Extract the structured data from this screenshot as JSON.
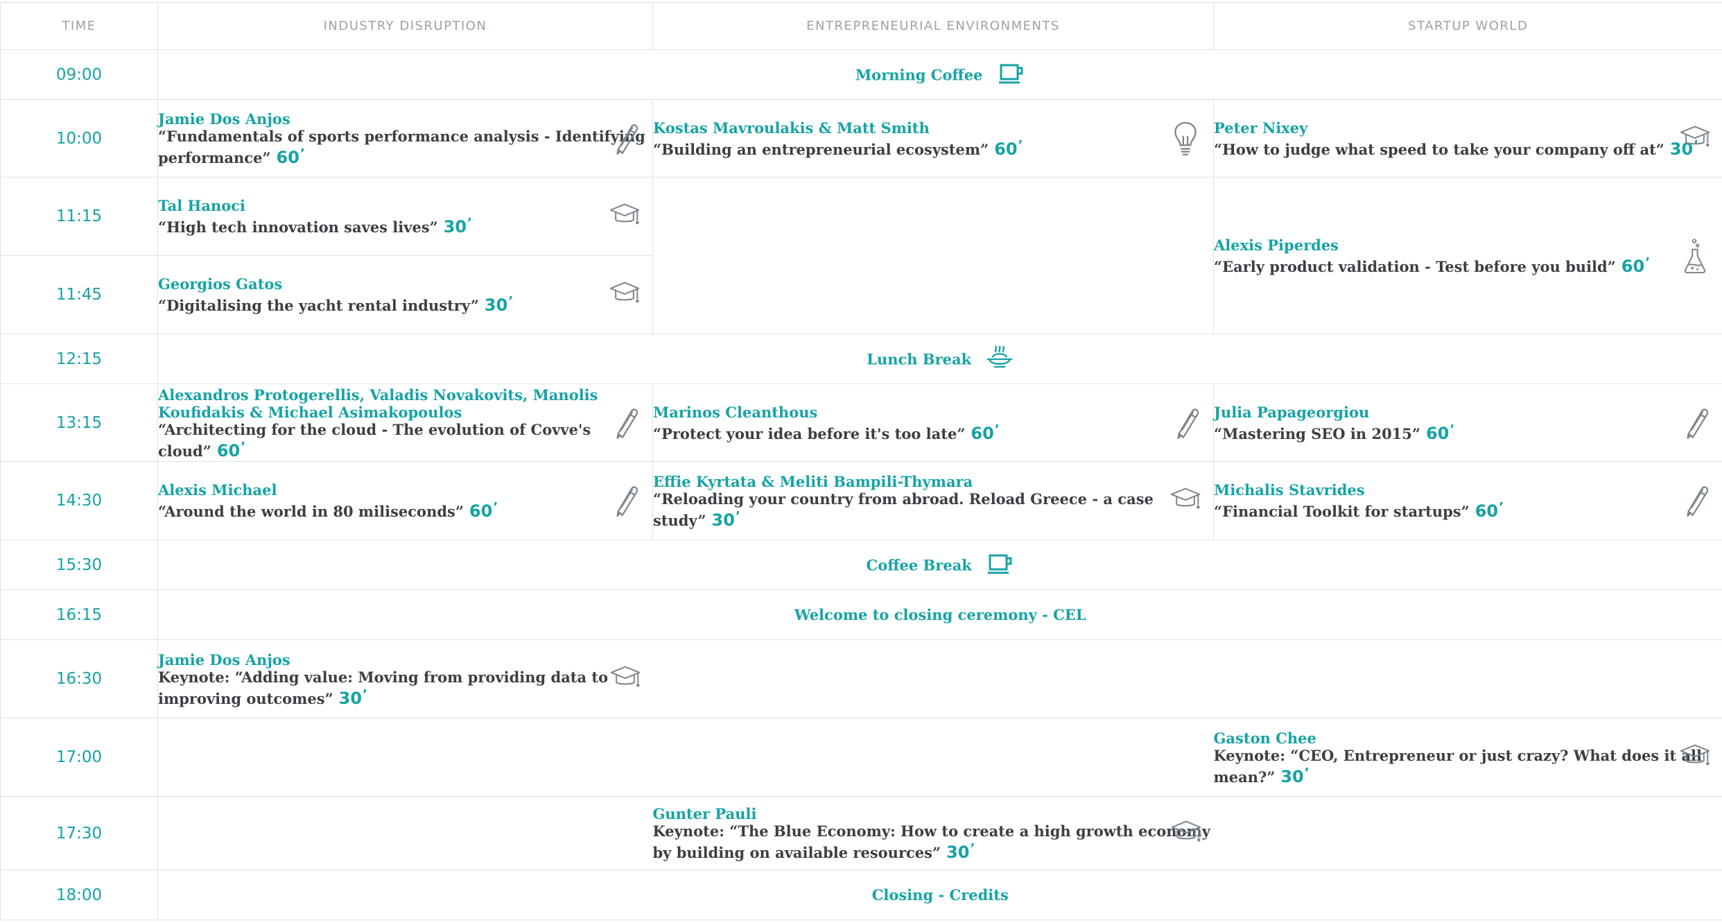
{
  "header": {
    "time": "TIME",
    "track1": "INDUSTRY DISRUPTION",
    "track2": "ENTREPRENEURIAL ENVIRONMENTS",
    "track3": "STARTUP WORLD"
  },
  "rows": {
    "r0900": {
      "time": "09:00",
      "label": "Morning Coffee",
      "icon": "coffee-cup-icon"
    },
    "r1000": {
      "time": "10:00",
      "t1": {
        "speaker": "Jamie Dos Anjos",
        "talk": "“Fundamentals of sports performance analysis - Identifying performance”",
        "duration": "60",
        "icon": "pencil-icon"
      },
      "t2": {
        "speaker": "Kostas Mavroulakis & Matt Smith",
        "talk": "“Building an entrepreneurial ecosystem”",
        "duration": "60",
        "icon": "lightbulb-icon"
      },
      "t3": {
        "speaker": "Peter Nixey",
        "talk": "“How to judge what speed to take your company off at”",
        "duration": "30",
        "icon": "graduation-cap-icon"
      }
    },
    "r1115": {
      "time": "11:15",
      "t1": {
        "speaker": "Tal Hanoci",
        "talk": "“High tech innovation saves lives”",
        "duration": "30",
        "icon": "graduation-cap-icon"
      },
      "t3": {
        "speaker": "Alexis Piperdes",
        "talk": "“Early product validation - Test before you build”",
        "duration": "60",
        "icon": "flask-icon"
      }
    },
    "r1145": {
      "time": "11:45",
      "t1": {
        "speaker": "Georgios Gatos",
        "talk": "“Digitalising the yacht rental industry”",
        "duration": "30",
        "icon": "graduation-cap-icon"
      }
    },
    "r1215": {
      "time": "12:15",
      "label": "Lunch Break",
      "icon": "food-bowl-icon"
    },
    "r1315": {
      "time": "13:15",
      "t1": {
        "speaker": "Alexandros Protogerellis, Valadis Novakovits, Manolis Koufidakis & Michael Asimakopoulos",
        "talk": "“Architecting for the cloud - The evolution of Covve's cloud”",
        "duration": "60",
        "icon": "pencil-icon"
      },
      "t2": {
        "speaker": "Marinos Cleanthous",
        "talk": "“Protect your idea before it's too late”",
        "duration": "60",
        "icon": "pencil-icon"
      },
      "t3": {
        "speaker": "Julia Papageorgiou",
        "talk": "“Mastering SEO in 2015”",
        "duration": "60",
        "icon": "pencil-icon"
      }
    },
    "r1430": {
      "time": "14:30",
      "t1": {
        "speaker": "Alexis Michael",
        "talk": "“Around the world in 80 miliseconds”",
        "duration": "60",
        "icon": "pencil-icon"
      },
      "t2": {
        "speaker": "Effie Kyrtata & Meliti Bampili-Thymara",
        "talk": "“Reloading your country from abroad. Reload Greece - a case study”",
        "duration": "30",
        "icon": "graduation-cap-icon"
      },
      "t3": {
        "speaker": "Michalis Stavrides",
        "talk": "“Financial Toolkit for startups”",
        "duration": "60",
        "icon": "pencil-icon"
      }
    },
    "r1530": {
      "time": "15:30",
      "label": "Coffee Break",
      "icon": "coffee-cup-icon"
    },
    "r1615": {
      "time": "16:15",
      "label": "Welcome to closing ceremony - CEL"
    },
    "r1630": {
      "time": "16:30",
      "t1": {
        "speaker": "Jamie Dos Anjos",
        "talk": "Keynote: “Adding value: Moving from providing data to improving outcomes”",
        "duration": "30",
        "icon": "graduation-cap-icon"
      }
    },
    "r1700": {
      "time": "17:00",
      "t3": {
        "speaker": "Gaston Chee",
        "talk": "Keynote: “CEO, Entrepreneur or just crazy? What does it all mean?”",
        "duration": "30",
        "icon": "graduation-cap-icon"
      }
    },
    "r1730": {
      "time": "17:30",
      "t2": {
        "speaker": "Gunter Pauli",
        "talk": "Keynote: “The Blue Economy: How to create a high growth economy by building on available resources”",
        "duration": "30",
        "icon": "graduation-cap-icon"
      }
    },
    "r1800": {
      "time": "18:00",
      "label": "Closing - Credits"
    }
  },
  "prime": "’",
  "colors": {
    "accent": "#16a3a5",
    "text": "#3b3f44",
    "muted": "#9aa2a8",
    "border": "#dfe3e6",
    "icon": "#7d868d"
  }
}
